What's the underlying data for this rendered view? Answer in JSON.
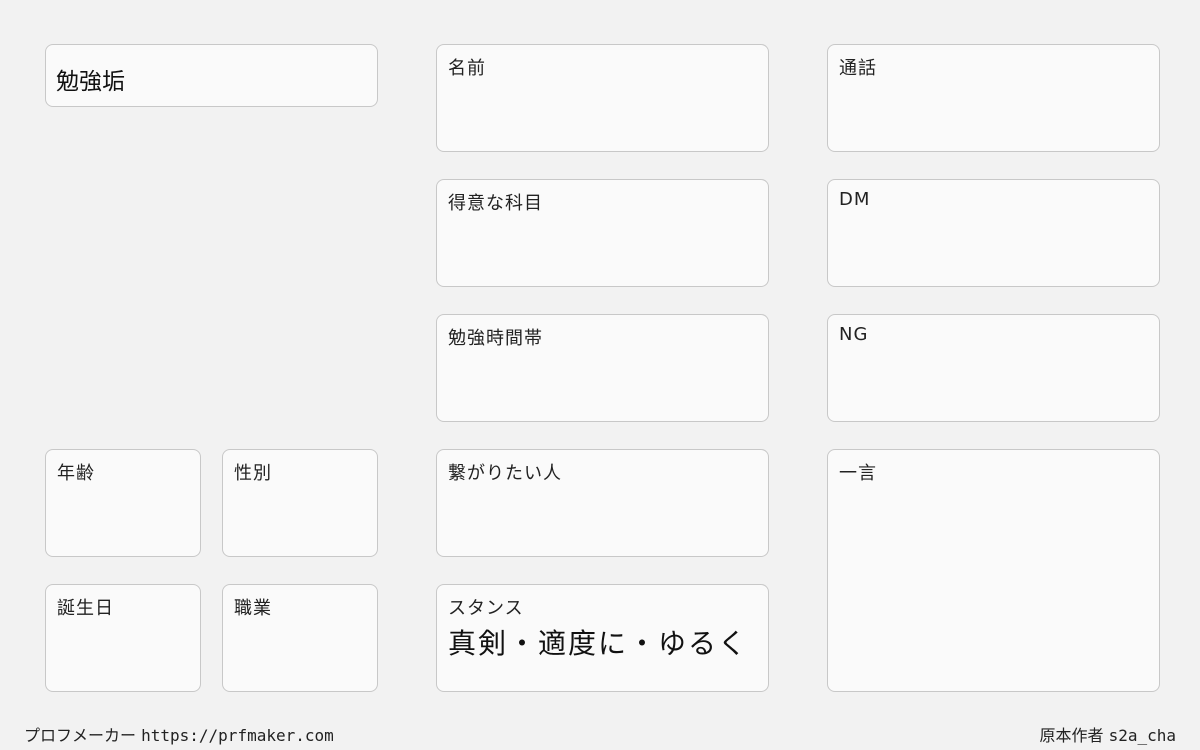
{
  "title": "勉強垢",
  "fields": {
    "name": "名前",
    "call": "通話",
    "subject": "得意な科目",
    "dm": "DM",
    "study_time": "勉強時間帯",
    "ng": "NG",
    "age": "年齢",
    "gender": "性別",
    "want_connect": "繋がりたい人",
    "one_word": "一言",
    "birthday": "誕生日",
    "job": "職業",
    "stance": "スタンス"
  },
  "stance_value": "真剣・適度に・ゆるく",
  "footer": {
    "app_name": "プロフメーカー",
    "url": "https://prfmaker.com",
    "author_label": "原本作者",
    "author": "s2a_cha"
  }
}
